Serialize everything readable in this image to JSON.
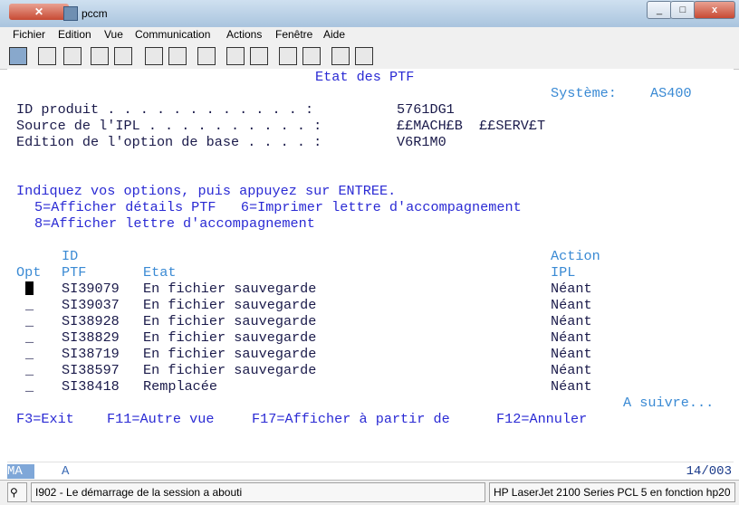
{
  "window": {
    "title": "pccm",
    "buttons": [
      "_",
      "□",
      "x"
    ]
  },
  "menu": [
    "Fichier",
    "Edition",
    "Vue",
    "Communication",
    "Actions",
    "Fenêtre",
    "Aide"
  ],
  "screen": {
    "title": "Etat des PTF",
    "system_label": "Système:",
    "system_value": "AS400",
    "fields": [
      {
        "label": "ID produit . . . . . . . . . . . . :",
        "value": "5761DG1"
      },
      {
        "label": "Source de l'IPL . . . . . . . . . . :",
        "value": "££MACH£B  ££SERV£T"
      },
      {
        "label": "Edition de l'option de base . . . . :",
        "value": "V6R1M0"
      }
    ],
    "instructions": "Indiquez vos options, puis appuyez sur ENTREE.",
    "options_line1": "5=Afficher détails PTF   6=Imprimer lettre d'accompagnement",
    "options_line2": "8=Afficher lettre d'accompagnement",
    "headers": {
      "opt": "Opt",
      "id_top": "ID",
      "id_bottom": "PTF",
      "etat": "Etat",
      "action_top": "Action",
      "action_bottom": "IPL"
    },
    "rows": [
      {
        "opt": "",
        "id": "SI39079",
        "etat": "En fichier sauvegarde",
        "action": "Néant"
      },
      {
        "opt": "_",
        "id": "SI39037",
        "etat": "En fichier sauvegarde",
        "action": "Néant"
      },
      {
        "opt": "_",
        "id": "SI38928",
        "etat": "En fichier sauvegarde",
        "action": "Néant"
      },
      {
        "opt": "_",
        "id": "SI38829",
        "etat": "En fichier sauvegarde",
        "action": "Néant"
      },
      {
        "opt": "_",
        "id": "SI38719",
        "etat": "En fichier sauvegarde",
        "action": "Néant"
      },
      {
        "opt": "_",
        "id": "SI38597",
        "etat": "En fichier sauvegarde",
        "action": "Néant"
      },
      {
        "opt": "_",
        "id": "SI38418",
        "etat": "Remplacée",
        "action": "Néant"
      }
    ],
    "more": "A suivre...",
    "fkeys": [
      "F3=Exit",
      "F11=Autre vue",
      "F17=Afficher à partir de",
      "F12=Annuler"
    ]
  },
  "oia": {
    "indicator": "MA",
    "mode": "A",
    "position": "14/003"
  },
  "status": {
    "message": "I902 - Le démarrage de la session a abouti",
    "printer": "HP LaserJet 2100 Series PCL 5 en fonction hp20"
  }
}
